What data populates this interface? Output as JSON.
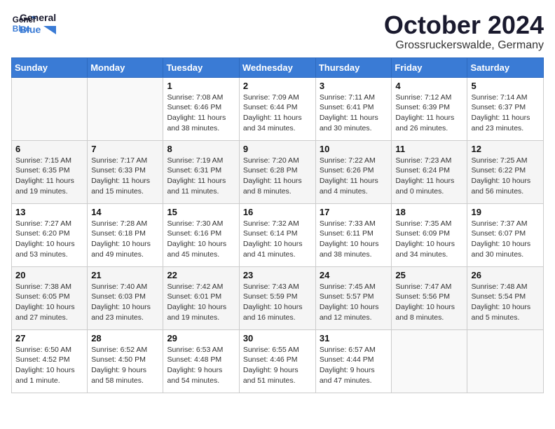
{
  "header": {
    "logo_line1": "General",
    "logo_line2": "Blue",
    "month_title": "October 2024",
    "location": "Grossruckerswalde, Germany"
  },
  "calendar": {
    "days_of_week": [
      "Sunday",
      "Monday",
      "Tuesday",
      "Wednesday",
      "Thursday",
      "Friday",
      "Saturday"
    ],
    "weeks": [
      [
        {
          "day": "",
          "content": ""
        },
        {
          "day": "",
          "content": ""
        },
        {
          "day": "1",
          "content": "Sunrise: 7:08 AM\nSunset: 6:46 PM\nDaylight: 11 hours and 38 minutes."
        },
        {
          "day": "2",
          "content": "Sunrise: 7:09 AM\nSunset: 6:44 PM\nDaylight: 11 hours and 34 minutes."
        },
        {
          "day": "3",
          "content": "Sunrise: 7:11 AM\nSunset: 6:41 PM\nDaylight: 11 hours and 30 minutes."
        },
        {
          "day": "4",
          "content": "Sunrise: 7:12 AM\nSunset: 6:39 PM\nDaylight: 11 hours and 26 minutes."
        },
        {
          "day": "5",
          "content": "Sunrise: 7:14 AM\nSunset: 6:37 PM\nDaylight: 11 hours and 23 minutes."
        }
      ],
      [
        {
          "day": "6",
          "content": "Sunrise: 7:15 AM\nSunset: 6:35 PM\nDaylight: 11 hours and 19 minutes."
        },
        {
          "day": "7",
          "content": "Sunrise: 7:17 AM\nSunset: 6:33 PM\nDaylight: 11 hours and 15 minutes."
        },
        {
          "day": "8",
          "content": "Sunrise: 7:19 AM\nSunset: 6:31 PM\nDaylight: 11 hours and 11 minutes."
        },
        {
          "day": "9",
          "content": "Sunrise: 7:20 AM\nSunset: 6:28 PM\nDaylight: 11 hours and 8 minutes."
        },
        {
          "day": "10",
          "content": "Sunrise: 7:22 AM\nSunset: 6:26 PM\nDaylight: 11 hours and 4 minutes."
        },
        {
          "day": "11",
          "content": "Sunrise: 7:23 AM\nSunset: 6:24 PM\nDaylight: 11 hours and 0 minutes."
        },
        {
          "day": "12",
          "content": "Sunrise: 7:25 AM\nSunset: 6:22 PM\nDaylight: 10 hours and 56 minutes."
        }
      ],
      [
        {
          "day": "13",
          "content": "Sunrise: 7:27 AM\nSunset: 6:20 PM\nDaylight: 10 hours and 53 minutes."
        },
        {
          "day": "14",
          "content": "Sunrise: 7:28 AM\nSunset: 6:18 PM\nDaylight: 10 hours and 49 minutes."
        },
        {
          "day": "15",
          "content": "Sunrise: 7:30 AM\nSunset: 6:16 PM\nDaylight: 10 hours and 45 minutes."
        },
        {
          "day": "16",
          "content": "Sunrise: 7:32 AM\nSunset: 6:14 PM\nDaylight: 10 hours and 41 minutes."
        },
        {
          "day": "17",
          "content": "Sunrise: 7:33 AM\nSunset: 6:11 PM\nDaylight: 10 hours and 38 minutes."
        },
        {
          "day": "18",
          "content": "Sunrise: 7:35 AM\nSunset: 6:09 PM\nDaylight: 10 hours and 34 minutes."
        },
        {
          "day": "19",
          "content": "Sunrise: 7:37 AM\nSunset: 6:07 PM\nDaylight: 10 hours and 30 minutes."
        }
      ],
      [
        {
          "day": "20",
          "content": "Sunrise: 7:38 AM\nSunset: 6:05 PM\nDaylight: 10 hours and 27 minutes."
        },
        {
          "day": "21",
          "content": "Sunrise: 7:40 AM\nSunset: 6:03 PM\nDaylight: 10 hours and 23 minutes."
        },
        {
          "day": "22",
          "content": "Sunrise: 7:42 AM\nSunset: 6:01 PM\nDaylight: 10 hours and 19 minutes."
        },
        {
          "day": "23",
          "content": "Sunrise: 7:43 AM\nSunset: 5:59 PM\nDaylight: 10 hours and 16 minutes."
        },
        {
          "day": "24",
          "content": "Sunrise: 7:45 AM\nSunset: 5:57 PM\nDaylight: 10 hours and 12 minutes."
        },
        {
          "day": "25",
          "content": "Sunrise: 7:47 AM\nSunset: 5:56 PM\nDaylight: 10 hours and 8 minutes."
        },
        {
          "day": "26",
          "content": "Sunrise: 7:48 AM\nSunset: 5:54 PM\nDaylight: 10 hours and 5 minutes."
        }
      ],
      [
        {
          "day": "27",
          "content": "Sunrise: 6:50 AM\nSunset: 4:52 PM\nDaylight: 10 hours and 1 minute."
        },
        {
          "day": "28",
          "content": "Sunrise: 6:52 AM\nSunset: 4:50 PM\nDaylight: 9 hours and 58 minutes."
        },
        {
          "day": "29",
          "content": "Sunrise: 6:53 AM\nSunset: 4:48 PM\nDaylight: 9 hours and 54 minutes."
        },
        {
          "day": "30",
          "content": "Sunrise: 6:55 AM\nSunset: 4:46 PM\nDaylight: 9 hours and 51 minutes."
        },
        {
          "day": "31",
          "content": "Sunrise: 6:57 AM\nSunset: 4:44 PM\nDaylight: 9 hours and 47 minutes."
        },
        {
          "day": "",
          "content": ""
        },
        {
          "day": "",
          "content": ""
        }
      ]
    ]
  }
}
